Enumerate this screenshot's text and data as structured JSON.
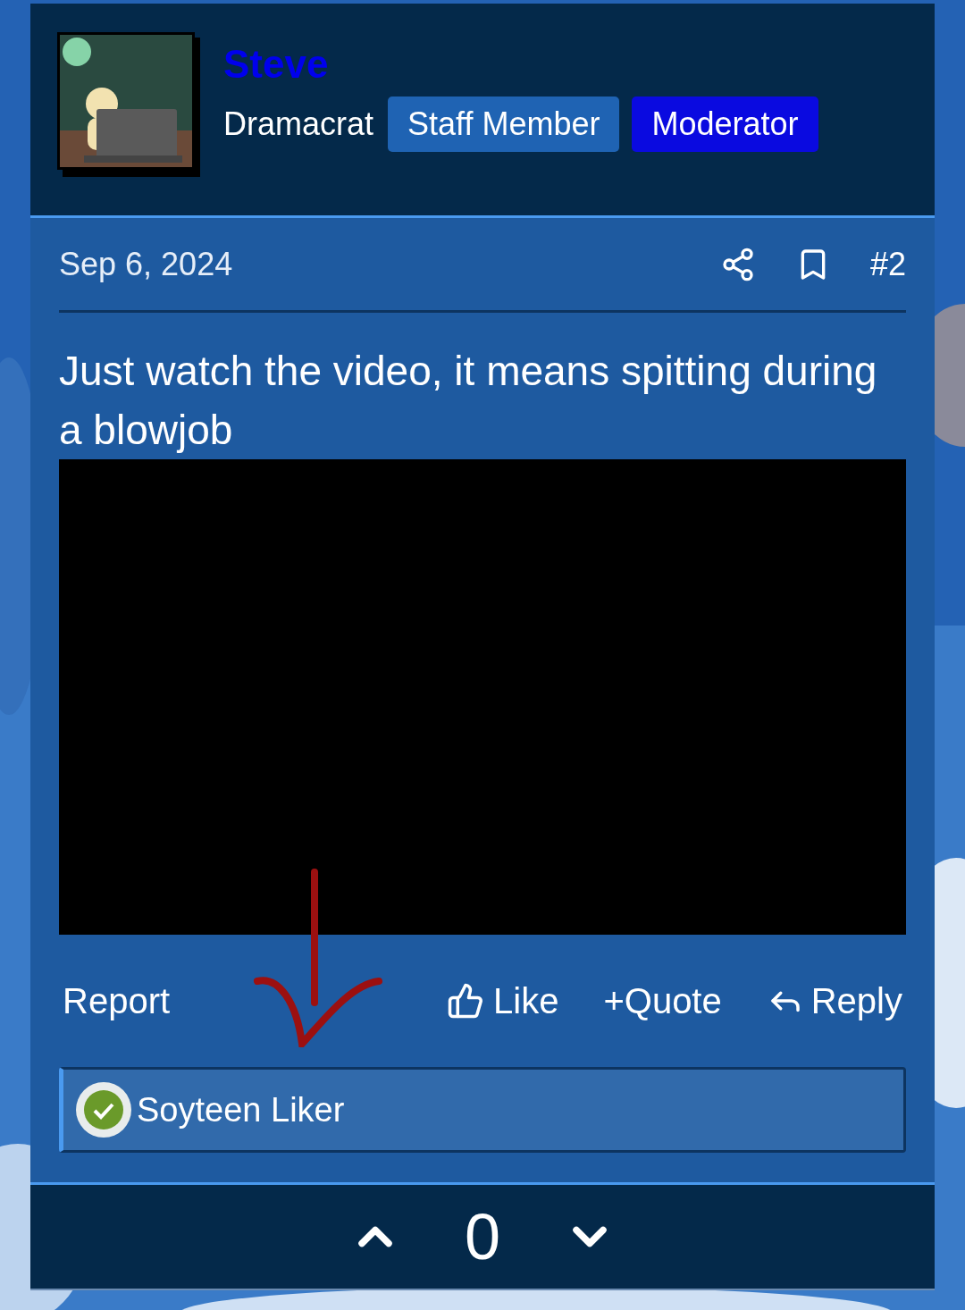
{
  "author": {
    "name": "Steve",
    "title": "Dramacrat",
    "badges": [
      {
        "label": "Staff Member",
        "color": "#1f63b3"
      },
      {
        "label": "Moderator",
        "color": "#0a0ae0"
      }
    ]
  },
  "post": {
    "date": "Sep 6, 2024",
    "number": "#2",
    "text": "Just watch the video, it means spitting during a blowjob"
  },
  "actions": {
    "report": "Report",
    "like": "Like",
    "quote": "Quote",
    "quote_icon": "+",
    "reply": "Reply"
  },
  "reactions": {
    "summary": "Soyteen Liker"
  },
  "votes": {
    "score": "0"
  }
}
